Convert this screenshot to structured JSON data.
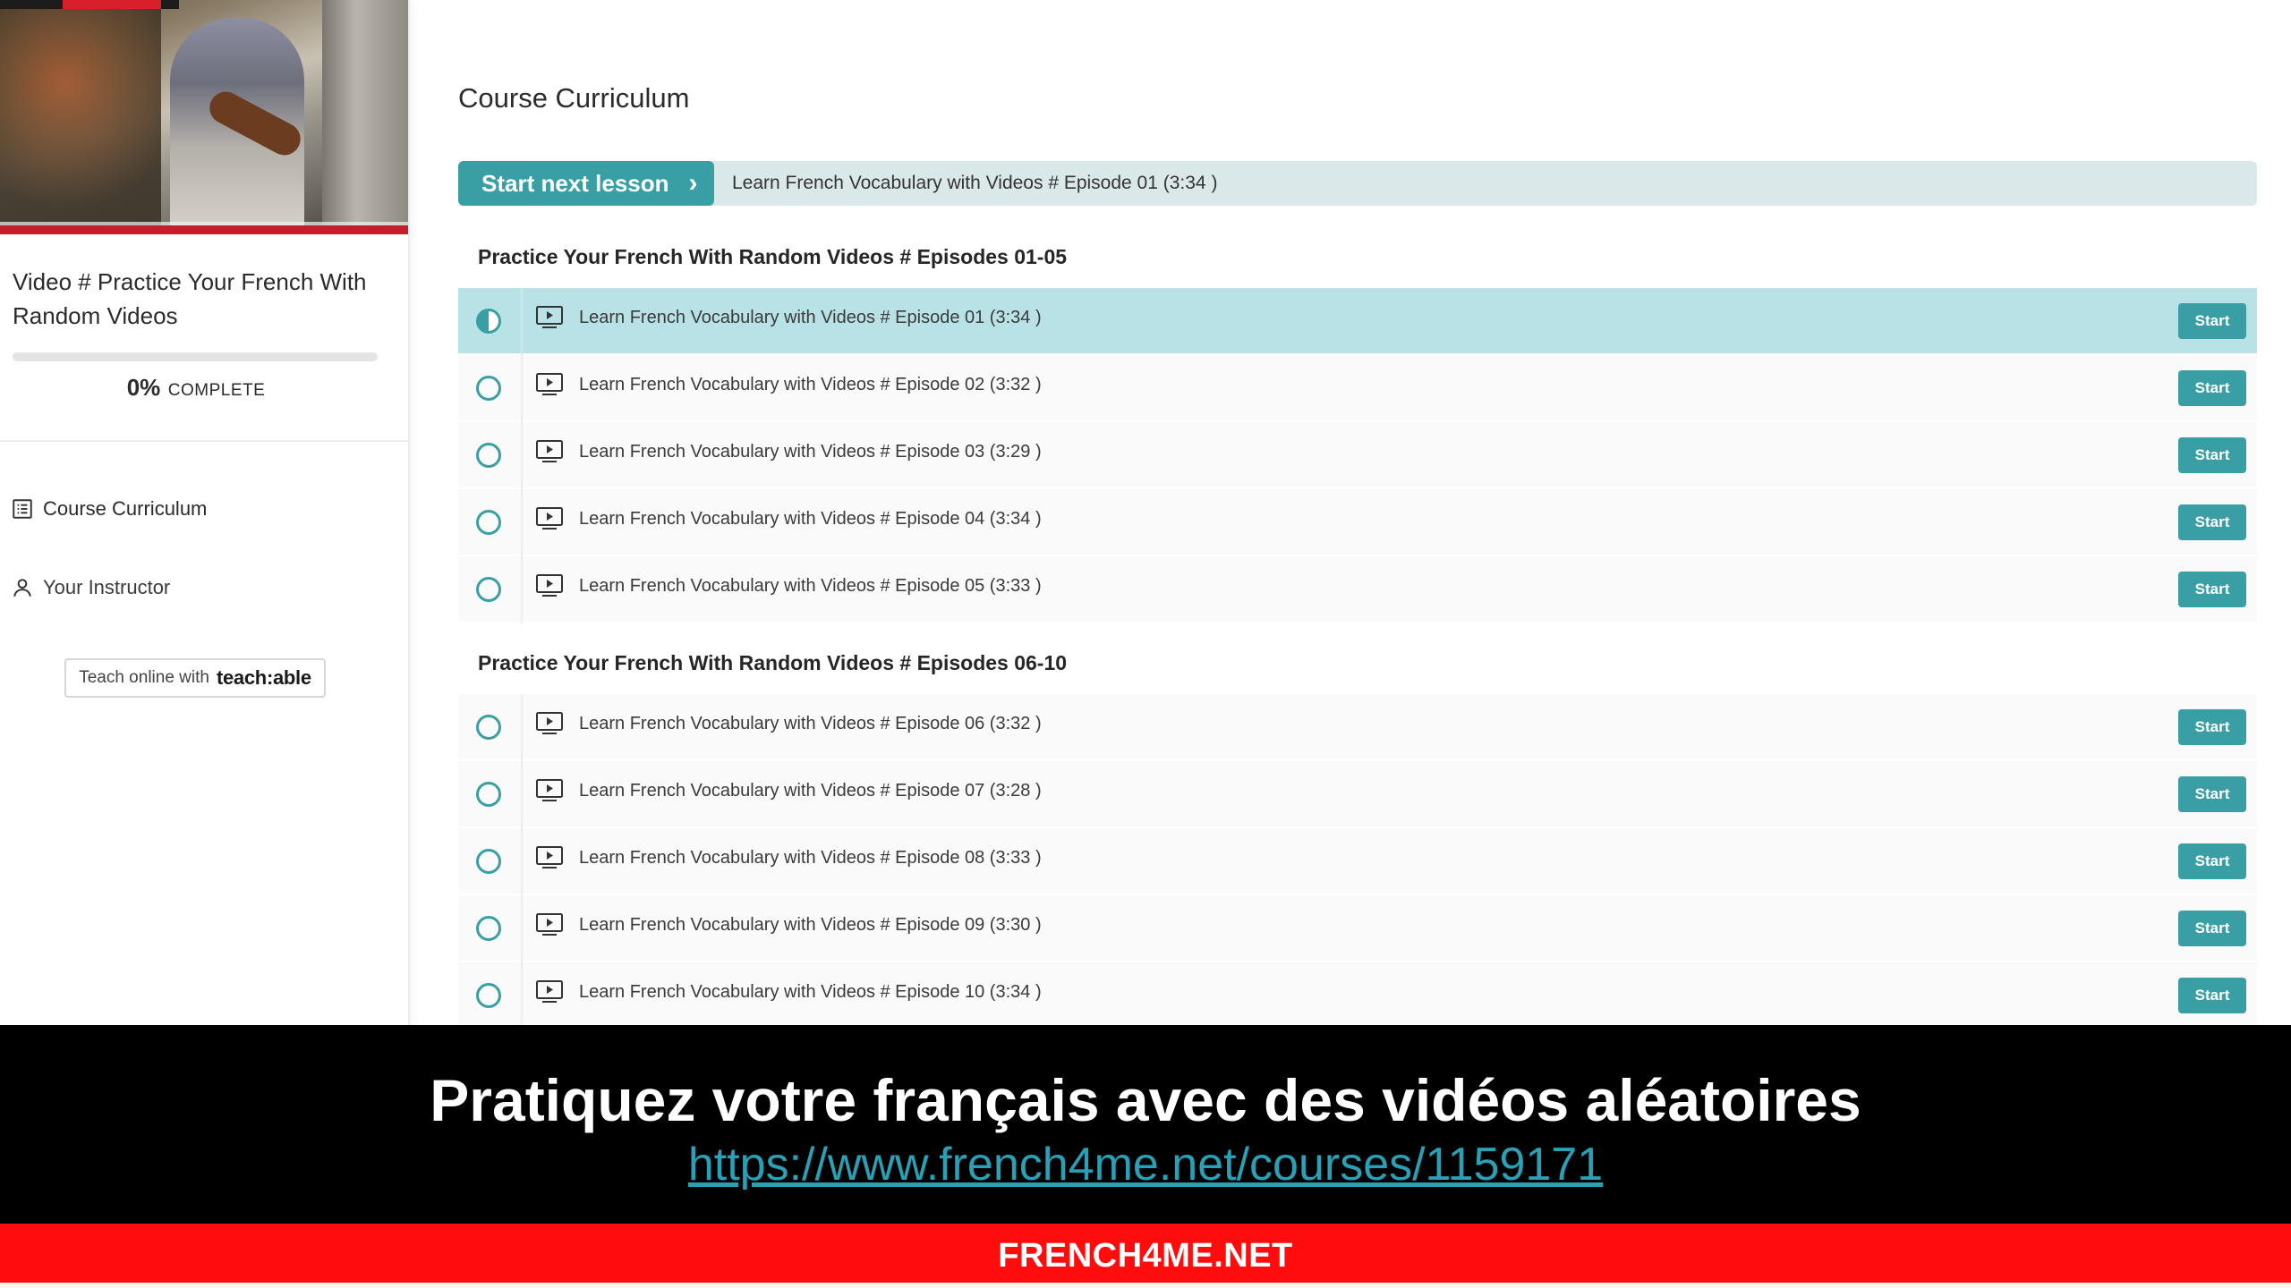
{
  "sidebar": {
    "course_title": "Video # Practice Your French With Random Videos",
    "progress": {
      "percent_value": 0,
      "percent": "0%",
      "word": "COMPLETE"
    },
    "nav": [
      {
        "label": "Course Curriculum",
        "icon": "list-icon"
      },
      {
        "label": "Your Instructor",
        "icon": "person-icon"
      }
    ],
    "teachable": {
      "prefix": "Teach online with",
      "brand": "teach:able"
    }
  },
  "main": {
    "title": "Course Curriculum",
    "next": {
      "button": "Start next lesson",
      "lesson": "Learn French Vocabulary with Videos # Episode 01 (3:34 )"
    },
    "sections": [
      {
        "title": "Practice Your French With Random Videos # Episodes 01-05",
        "lessons": [
          {
            "title": "Learn French Vocabulary with Videos # Episode 01 (3:34 )",
            "action": "Start",
            "status": "in-progress"
          },
          {
            "title": "Learn French Vocabulary with Videos # Episode 02 (3:32 )",
            "action": "Start",
            "status": "not-started"
          },
          {
            "title": "Learn French Vocabulary with Videos # Episode 03 (3:29 )",
            "action": "Start",
            "status": "not-started"
          },
          {
            "title": "Learn French Vocabulary with Videos # Episode 04 (3:34 )",
            "action": "Start",
            "status": "not-started"
          },
          {
            "title": "Learn French Vocabulary with Videos # Episode 05 (3:33 )",
            "action": "Start",
            "status": "not-started"
          }
        ]
      },
      {
        "title": "Practice Your French With Random Videos # Episodes 06-10",
        "lessons": [
          {
            "title": "Learn French Vocabulary with Videos # Episode 06 (3:32 )",
            "action": "Start",
            "status": "not-started"
          },
          {
            "title": "Learn French Vocabulary with Videos # Episode 07 (3:28 )",
            "action": "Start",
            "status": "not-started"
          },
          {
            "title": "Learn French Vocabulary with Videos # Episode 08 (3:33 )",
            "action": "Start",
            "status": "not-started"
          },
          {
            "title": "Learn French Vocabulary with Videos # Episode 09 (3:30 )",
            "action": "Start",
            "status": "not-started"
          },
          {
            "title": "Learn French Vocabulary with Videos # Episode 10 (3:34 )",
            "action": "Start",
            "status": "not-started"
          }
        ]
      }
    ]
  },
  "overlay": {
    "headline": "Pratiquez votre français avec des vidéos aléatoires",
    "url": "https://www.french4me.net/courses/1159171",
    "footer": "FRENCH4ME.NET"
  },
  "colors": {
    "accent": "#3a9fa4",
    "active_row": "#b8e2e6",
    "next_bar": "#dbe8ea",
    "banner": "#000000",
    "footer": "#ff0d0d",
    "link": "#29a0b5"
  }
}
